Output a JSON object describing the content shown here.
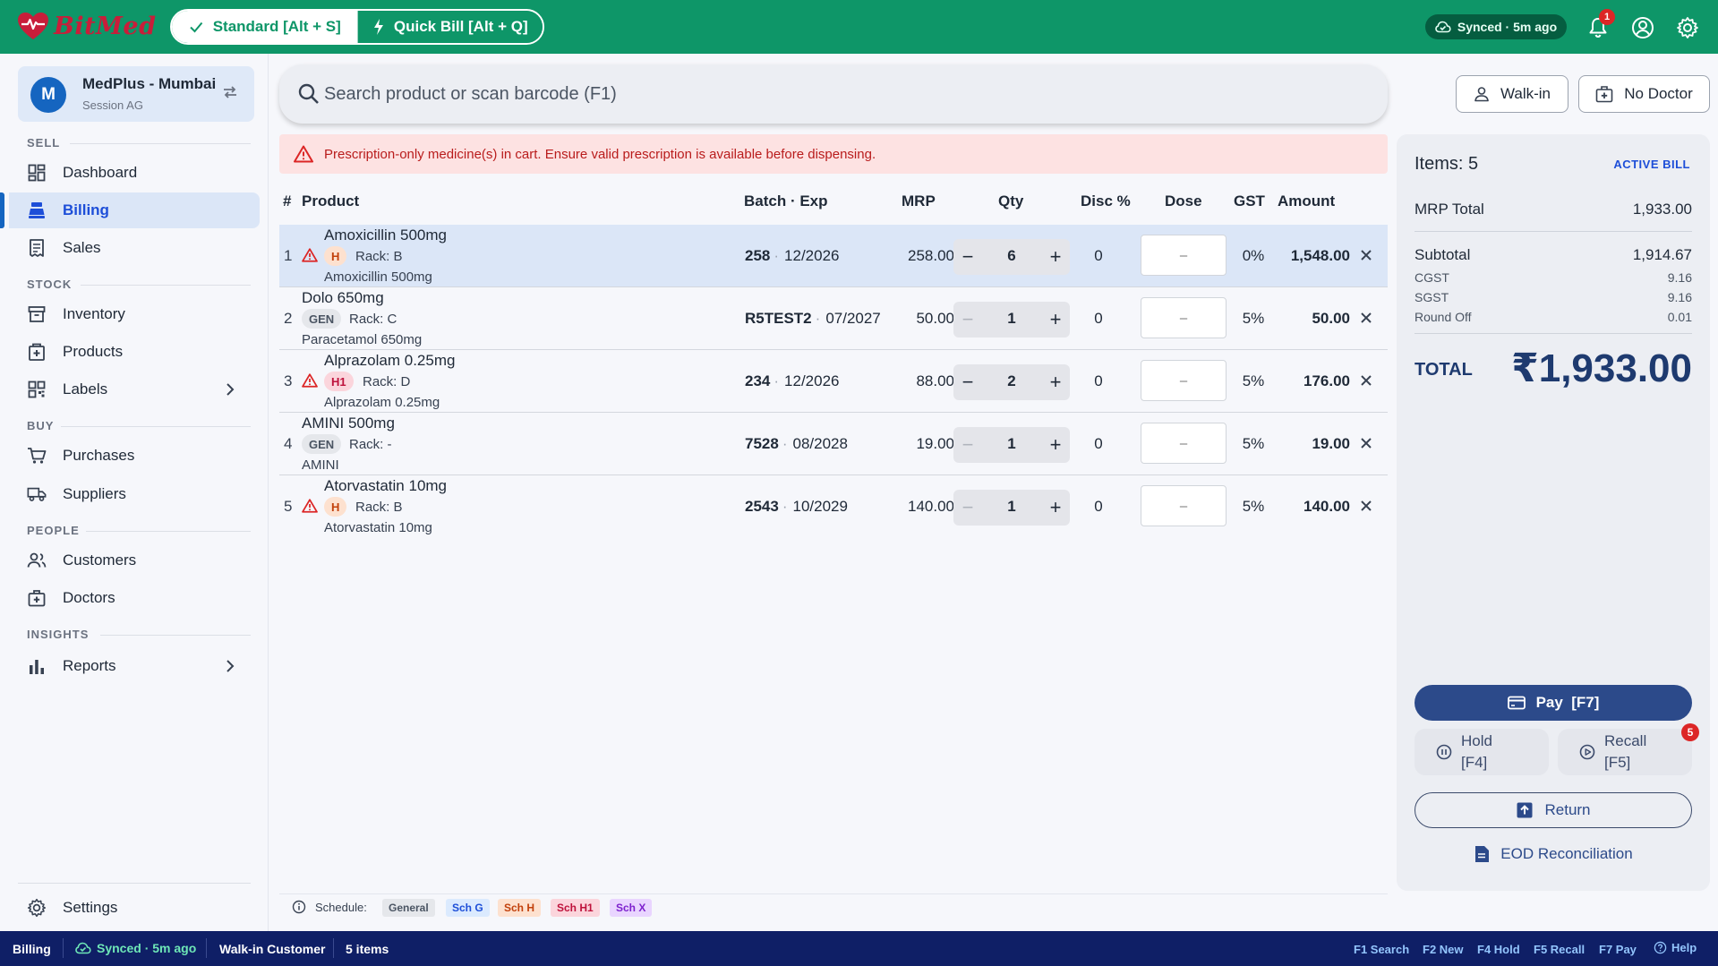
{
  "app": {
    "brand": "BitMed",
    "mode_standard": "Standard [Alt + S]",
    "mode_quick": "Quick Bill [Alt + Q]",
    "sync_status": "Synced · 5m ago",
    "notification_count": "1"
  },
  "sidebar": {
    "store_initial": "M",
    "store_name": "MedPlus - Mumbai",
    "session": "Session AG",
    "sections": {
      "sell": "SELL",
      "stock": "STOCK",
      "buy": "BUY",
      "people": "PEOPLE",
      "insights": "INSIGHTS"
    },
    "items": {
      "dashboard": "Dashboard",
      "billing": "Billing",
      "sales": "Sales",
      "inventory": "Inventory",
      "products": "Products",
      "labels": "Labels",
      "purchases": "Purchases",
      "suppliers": "Suppliers",
      "customers": "Customers",
      "doctors": "Doctors",
      "reports": "Reports",
      "settings": "Settings"
    }
  },
  "search": {
    "placeholder": "Search product or scan barcode (F1)"
  },
  "buttons": {
    "walkin": "Walk-in",
    "no_doctor": "No Doctor"
  },
  "alert": "Prescription-only medicine(s) in cart. Ensure valid prescription is available before dispensing.",
  "table": {
    "headers": {
      "num": "#",
      "product": "Product",
      "batch_exp": "Batch · Exp",
      "mrp": "MRP",
      "qty": "Qty",
      "disc": "Disc %",
      "dose": "Dose",
      "gst": "GST",
      "amount": "Amount"
    },
    "dose_placeholder": "–",
    "rows": [
      {
        "num": "1",
        "name": "Amoxicillin 500mg",
        "schedule": "H",
        "rack": "Rack: B",
        "generic": "Amoxicillin 500mg",
        "batch": "258",
        "exp": "12/2026",
        "mrp": "258.00",
        "qty": "6",
        "disc": "0",
        "gst": "0%",
        "amount": "1,548.00"
      },
      {
        "num": "2",
        "name": "Dolo 650mg",
        "schedule": "GEN",
        "rack": "Rack: C",
        "generic": "Paracetamol 650mg",
        "batch": "R5TEST2",
        "exp": "07/2027",
        "mrp": "50.00",
        "qty": "1",
        "disc": "0",
        "gst": "5%",
        "amount": "50.00"
      },
      {
        "num": "3",
        "name": "Alprazolam 0.25mg",
        "schedule": "H1",
        "rack": "Rack: D",
        "generic": "Alprazolam 0.25mg",
        "batch": "234",
        "exp": "12/2026",
        "mrp": "88.00",
        "qty": "2",
        "disc": "0",
        "gst": "5%",
        "amount": "176.00"
      },
      {
        "num": "4",
        "name": "AMINI 500mg",
        "schedule": "GEN",
        "rack": "Rack: -",
        "generic": "AMINI",
        "batch": "7528",
        "exp": "08/2028",
        "mrp": "19.00",
        "qty": "1",
        "disc": "0",
        "gst": "5%",
        "amount": "19.00"
      },
      {
        "num": "5",
        "name": "Atorvastatin 10mg",
        "schedule": "H",
        "rack": "Rack: B",
        "generic": "Atorvastatin 10mg",
        "batch": "2543",
        "exp": "10/2029",
        "mrp": "140.00",
        "qty": "1",
        "disc": "0",
        "gst": "5%",
        "amount": "140.00"
      }
    ]
  },
  "legend": {
    "title": "Schedule:",
    "general": "General",
    "sch_g": "Sch G",
    "sch_h": "Sch H",
    "sch_h1": "Sch H1",
    "sch_x": "Sch X"
  },
  "bill": {
    "items_label": "Items: 5",
    "status": "ACTIVE BILL",
    "mrp_total_label": "MRP Total",
    "mrp_total": "1,933.00",
    "subtotal_label": "Subtotal",
    "subtotal": "1,914.67",
    "cgst_label": "CGST",
    "cgst": "9.16",
    "sgst_label": "SGST",
    "sgst": "9.16",
    "roundoff_label": "Round Off",
    "roundoff": "0.01",
    "total_label": "TOTAL",
    "total": "₹1,933.00",
    "pay": "Pay  [F7]",
    "hold_l1": "Hold",
    "hold_l2": "[F4]",
    "recall_l1": "Recall",
    "recall_l2": "[F5]",
    "recall_count": "5",
    "return": "Return",
    "eod": "EOD Reconciliation"
  },
  "statusbar": {
    "page": "Billing",
    "sync": "Synced · 5m ago",
    "customer": "Walk-in Customer",
    "items": "5 items",
    "shortcuts": {
      "f1": "F1 Search",
      "f2": "F2 New",
      "f4": "F4 Hold",
      "f5": "F5 Recall",
      "f7": "F7 Pay",
      "help": "Help"
    }
  },
  "colors": {
    "brand_green": "#0e9668",
    "navy": "#0f1f66",
    "accent_blue": "#2c4a8a",
    "alert_red": "#b91c1c"
  }
}
